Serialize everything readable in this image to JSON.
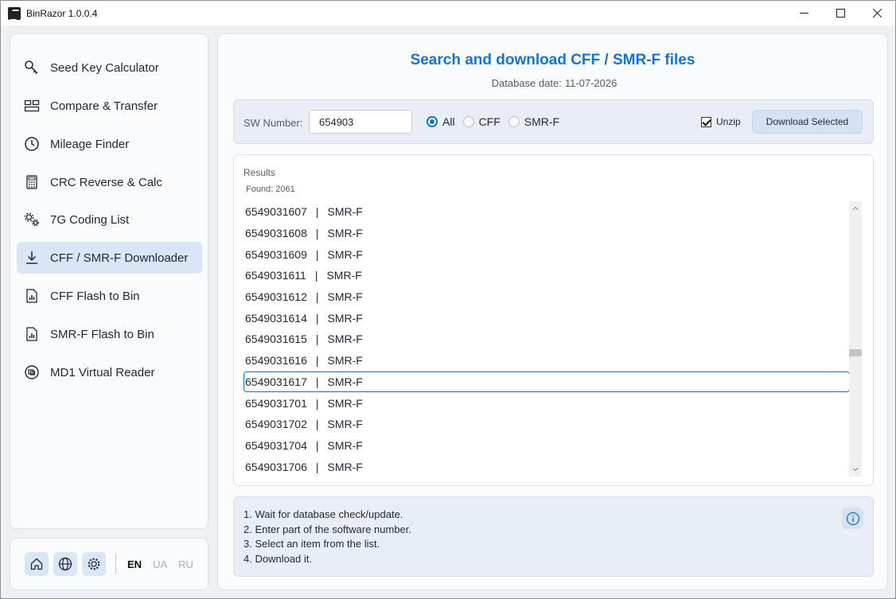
{
  "window": {
    "title": "BinRazor 1.0.0.4"
  },
  "sidebar": {
    "items": [
      {
        "label": "Seed Key Calculator",
        "icon": "key-icon"
      },
      {
        "label": "Compare & Transfer",
        "icon": "compare-icon"
      },
      {
        "label": "Mileage Finder",
        "icon": "clock-icon"
      },
      {
        "label": "CRC Reverse & Calc",
        "icon": "calculator-icon"
      },
      {
        "label": "7G Coding List",
        "icon": "gears-icon"
      },
      {
        "label": "CFF / SMR-F Downloader",
        "icon": "download-icon",
        "active": true
      },
      {
        "label": "CFF Flash to Bin",
        "icon": "file-chart-icon"
      },
      {
        "label": "SMR-F Flash to Bin",
        "icon": "file-chart-icon"
      },
      {
        "label": "MD1 Virtual Reader",
        "icon": "chip-icon"
      }
    ],
    "languages": [
      "EN",
      "UA",
      "RU"
    ],
    "active_language": "EN"
  },
  "main": {
    "title": "Search and download CFF / SMR-F files",
    "db_date_label": "Database date:",
    "db_date_value": "11-07-2026",
    "search": {
      "sw_label": "SW Number:",
      "sw_value": "654903",
      "filters": [
        {
          "label": "All",
          "checked": true
        },
        {
          "label": "CFF",
          "checked": false
        },
        {
          "label": "SMR-F",
          "checked": false
        }
      ],
      "unzip_label": "Unzip",
      "unzip_checked": true,
      "download_label": "Download Selected"
    },
    "results": {
      "label": "Results",
      "found_label": "Found:",
      "found_value": "2061",
      "separator": "|",
      "items": [
        {
          "number": "6549031607",
          "type": "SMR-F"
        },
        {
          "number": "6549031608",
          "type": "SMR-F"
        },
        {
          "number": "6549031609",
          "type": "SMR-F"
        },
        {
          "number": "6549031611",
          "type": "SMR-F"
        },
        {
          "number": "6549031612",
          "type": "SMR-F"
        },
        {
          "number": "6549031614",
          "type": "SMR-F"
        },
        {
          "number": "6549031615",
          "type": "SMR-F"
        },
        {
          "number": "6549031616",
          "type": "SMR-F"
        },
        {
          "number": "6549031617",
          "type": "SMR-F",
          "selected": true
        },
        {
          "number": "6549031701",
          "type": "SMR-F"
        },
        {
          "number": "6549031702",
          "type": "SMR-F"
        },
        {
          "number": "6549031704",
          "type": "SMR-F"
        },
        {
          "number": "6549031706",
          "type": "SMR-F"
        }
      ]
    },
    "help": {
      "lines": [
        "1. Wait for database check/update.",
        "2. Enter part of the software number.",
        "3. Select an item from the list.",
        "4. Download it."
      ]
    }
  },
  "colors": {
    "accent": "#1673d1",
    "active_bg": "#d9e6f7"
  }
}
